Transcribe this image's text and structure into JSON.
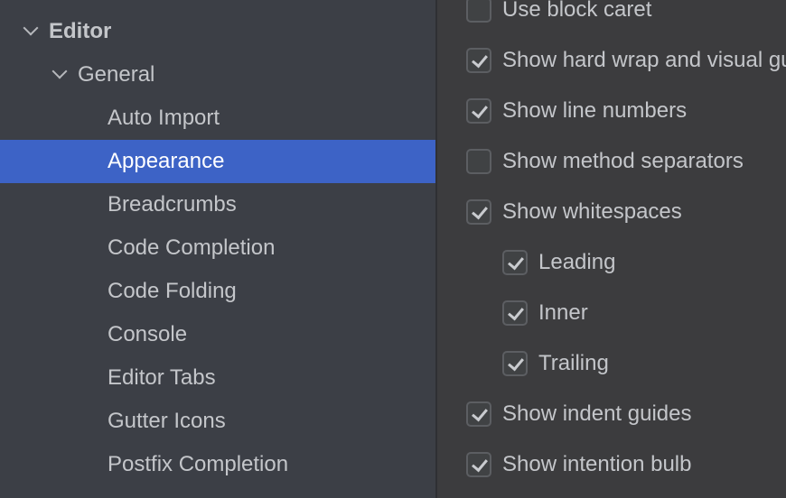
{
  "sidebar": {
    "items": [
      {
        "label": "Editor",
        "bold": true,
        "expanded": true
      },
      {
        "label": "General",
        "expanded": true
      },
      {
        "label": "Auto Import"
      },
      {
        "label": "Appearance",
        "selected": true
      },
      {
        "label": "Breadcrumbs"
      },
      {
        "label": "Code Completion"
      },
      {
        "label": "Code Folding"
      },
      {
        "label": "Console"
      },
      {
        "label": "Editor Tabs"
      },
      {
        "label": "Gutter Icons"
      },
      {
        "label": "Postfix Completion"
      }
    ]
  },
  "options": [
    {
      "label": "Use block caret",
      "checked": false
    },
    {
      "label": "Show hard wrap and visual guides",
      "checked": true
    },
    {
      "label": "Show line numbers",
      "checked": true
    },
    {
      "label": "Show method separators",
      "checked": false
    },
    {
      "label": "Show whitespaces",
      "checked": true
    },
    {
      "label": "Leading",
      "checked": true
    },
    {
      "label": "Inner",
      "checked": true
    },
    {
      "label": "Trailing",
      "checked": true
    },
    {
      "label": "Show indent guides",
      "checked": true
    },
    {
      "label": "Show intention bulb",
      "checked": true
    }
  ]
}
